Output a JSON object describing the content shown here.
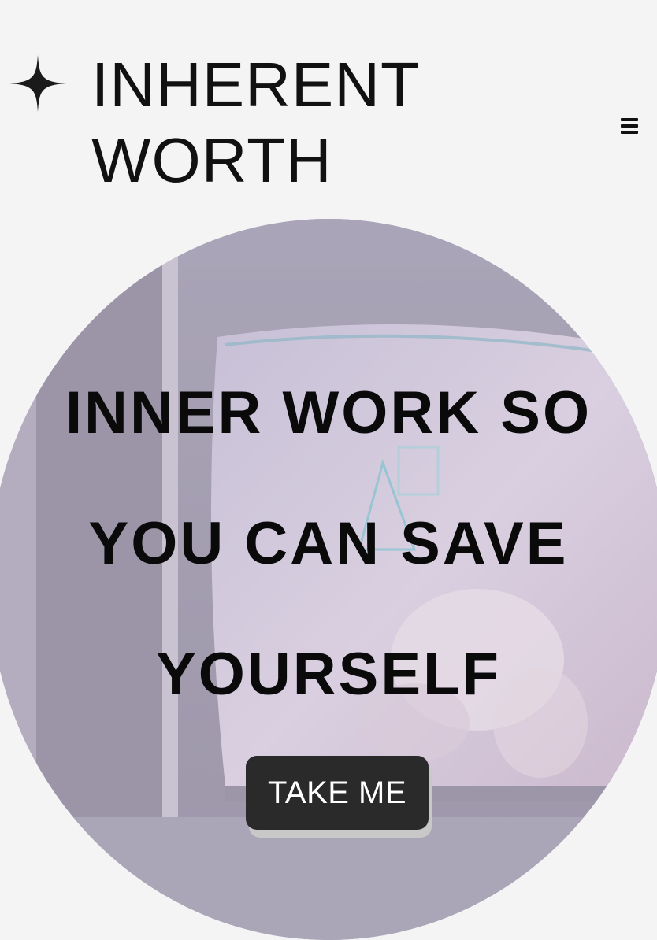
{
  "brand": {
    "line1": "INHERENT",
    "line2": "WORTH",
    "logo_icon": "four-point-star-icon"
  },
  "nav": {
    "menu_icon": "hamburger-menu-icon"
  },
  "hero": {
    "line1": "INNER WORK SO",
    "line2": "YOU CAN SAVE",
    "line3": "YOURSELF",
    "cta_label": "TAKE ME",
    "background_image": "retro television screen with lavender tint"
  },
  "colors": {
    "page_bg": "#f4f4f5",
    "text": "#111111",
    "hero_tint": "#b9b3c4",
    "button_bg": "#2a2a2a",
    "button_text": "#ffffff"
  }
}
